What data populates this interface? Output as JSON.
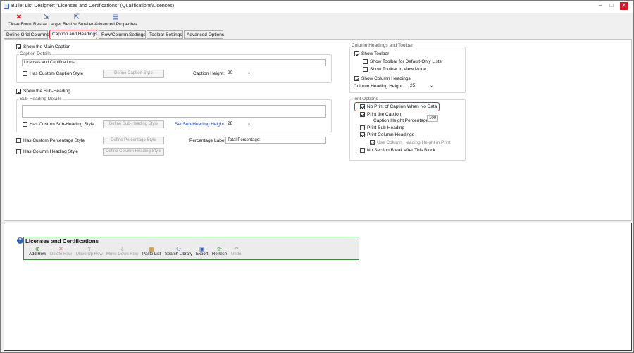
{
  "window": {
    "title": "Bullet List Designer: \"Licenses and Certifications\" (Qualifications\\Licenses)",
    "minimize": "–",
    "maximize": "□",
    "close": "✕"
  },
  "toolbar": {
    "close_form": "Close Form",
    "resize_larger": "Resize Larger",
    "resize_smaller": "Resize Smaller",
    "advanced_properties": "Advanced Properties"
  },
  "tabs": [
    {
      "label": "Define Grid Columns"
    },
    {
      "label": "Caption and Headings"
    },
    {
      "label": "Row/Column Settings"
    },
    {
      "label": "Toolbar Settings"
    },
    {
      "label": "Advanced Options"
    }
  ],
  "left": {
    "show_main_caption": "Show the Main Caption",
    "caption_details": "Caption Details",
    "caption_value": "Licenses and Certifications",
    "has_custom_caption_style": "Has Custom Caption Style",
    "define_caption_style": "Define Caption Style",
    "caption_height_label": "Caption Height:",
    "caption_height_value": "20",
    "show_sub_heading": "Show the Sub-Heading",
    "sub_heading_details": "Sub-Heading Details",
    "has_custom_sub_heading_style": "Has Custom Sub-Heading Style",
    "define_sub_heading_style": "Define Sub-Heading Style",
    "set_sub_heading_height": "Set Sub-Heading Height:",
    "sub_heading_height_value": "28",
    "has_custom_percentage_style": "Has Custom Percentage Style",
    "define_percentage_style": "Define Percentage Style",
    "percentage_label": "Percentage Label:",
    "percentage_value": "Total Percentage:",
    "has_column_heading_style": "Has Column Heading Style",
    "define_column_heading_style": "Define Column Heading Style"
  },
  "right": {
    "column_headings_toolbar": "Column Headings and Toolbar",
    "show_toolbar": "Show Toolbar",
    "show_toolbar_default_only": "Show Toolbar for Default-Only Lists",
    "show_toolbar_view_mode": "Show Toolbar in View Mode",
    "show_column_headings": "Show Column Headings",
    "column_heading_height_label": "Column Heading Height:",
    "column_heading_height_value": "25",
    "print_options": "Print Options",
    "no_print_caption": "No Print of Caption When No Data",
    "print_caption": "Print the Caption",
    "caption_height_pct_label": "Caption Height Percentage:",
    "caption_height_pct_value": "100",
    "print_sub_heading": "Print Sub-Heading",
    "print_column_headings": "Print Column Headings",
    "use_column_heading_height": "Use Column Heading Height in Print",
    "no_section_break": "No Section Break after This Block"
  },
  "preview": {
    "help": "?",
    "title": "Licenses and Certifications",
    "buttons": {
      "add_row": "Add Row",
      "delete_row": "Delete Row",
      "move_up_row": "Move Up Row",
      "move_down_row": "Move Down Row",
      "paste_list": "Paste List",
      "search_library": "Search Library",
      "export": "Export",
      "refresh": "Refresh",
      "undo": "Undo"
    }
  },
  "colors": {
    "highlight": "#e0252a",
    "link_blue": "#1a43c9",
    "preview_border": "#3c8a3c"
  }
}
